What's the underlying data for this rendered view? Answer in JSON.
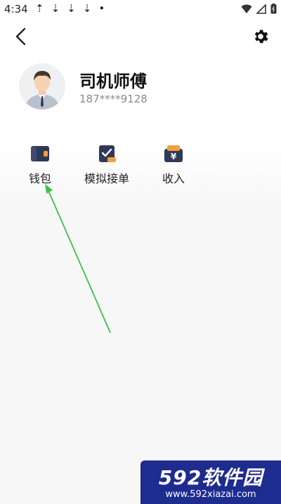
{
  "status_bar": {
    "time": "4:34",
    "icons": [
      "download-arrow-icon",
      "download-arrow-icon",
      "download-arrow-icon",
      "download-arrow-icon",
      "dot-icon"
    ]
  },
  "profile": {
    "name": "司机师傅",
    "phone": "187****9128"
  },
  "menu": [
    {
      "label": "钱包",
      "icon": "wallet-icon"
    },
    {
      "label": "模拟接单",
      "icon": "order-check-icon"
    },
    {
      "label": "收入",
      "icon": "income-yen-icon"
    }
  ],
  "watermark": {
    "brand": "592软件园",
    "url": "www.592xiazai.com"
  },
  "colors": {
    "icon_dark": "#2e3a57",
    "icon_accent": "#f0a13a",
    "annotation_arrow": "#3bc34a",
    "watermark_bg": "#1e2b8f"
  }
}
